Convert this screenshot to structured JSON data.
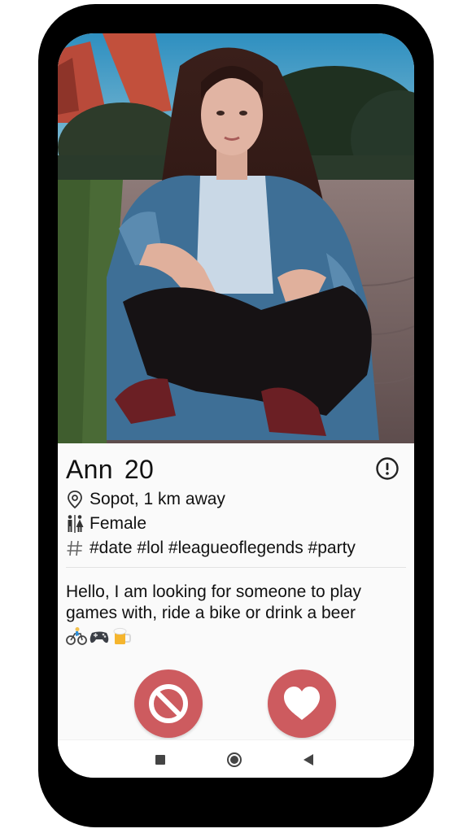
{
  "profile": {
    "name": "Ann",
    "age": "20",
    "location": "Sopot, 1 km away",
    "gender": "Female",
    "tags": "#date #lol #leagueoflegends #party",
    "bio": "Hello, I am looking for someone to play games with, ride a bike or drink a beer",
    "bio_emojis": [
      "bicyclist",
      "video-game-controller",
      "beer-mug"
    ]
  },
  "icons": {
    "location": "map-pin-icon",
    "gender": "restroom-icon",
    "tags": "hashtag-icon",
    "report": "exclamation-circle-icon",
    "dislike": "no-entry-icon",
    "like": "heart-icon"
  },
  "colors": {
    "accent": "#cd5b5f",
    "frame": "#000000",
    "background": "#fafafa"
  }
}
